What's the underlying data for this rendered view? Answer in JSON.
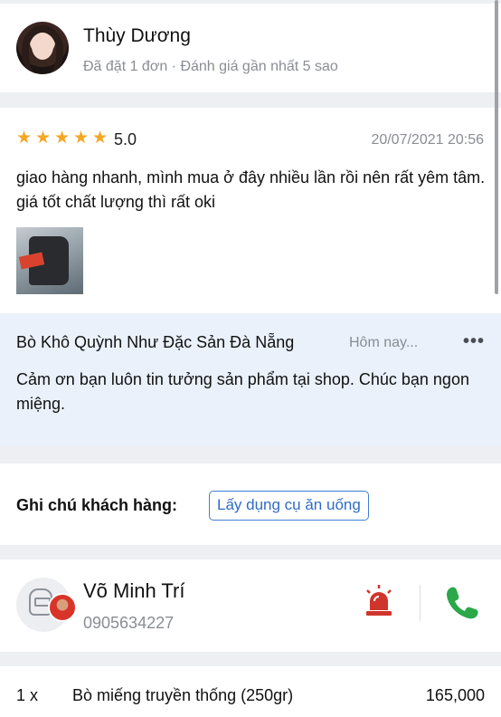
{
  "customer": {
    "name": "Thùy Dương",
    "meta": "Đã đặt 1 đơn · Đánh giá gần nhất 5 sao"
  },
  "review": {
    "stars": 5,
    "rating": "5.0",
    "date": "20/07/2021 20:56",
    "text": "giao hàng nhanh, mình mua ở đây nhiều lần rồi nên rất yêm tâm. giá tốt chất lượng thì rất oki"
  },
  "reply": {
    "shop_name": "Bò Khô Quỳnh Như  Đặc Sản Đà Nẵng",
    "time": "Hôm nay...",
    "more": "•••",
    "text": "Cảm ơn bạn luôn tin tưởng sản phẩm tại shop. Chúc bạn ngon miệng."
  },
  "notes": {
    "label": "Ghi chú khách hàng:",
    "tag": "Lấy dụng cụ ăn uống"
  },
  "driver": {
    "name": "Võ Minh Trí",
    "phone": "0905634227",
    "alarm_icon_color": "#d0352b",
    "call_icon_color": "#2aa84a"
  },
  "order": {
    "qty": "1 x",
    "item": "Bò miếng truyền thống (250gr)",
    "price": "165,000"
  }
}
